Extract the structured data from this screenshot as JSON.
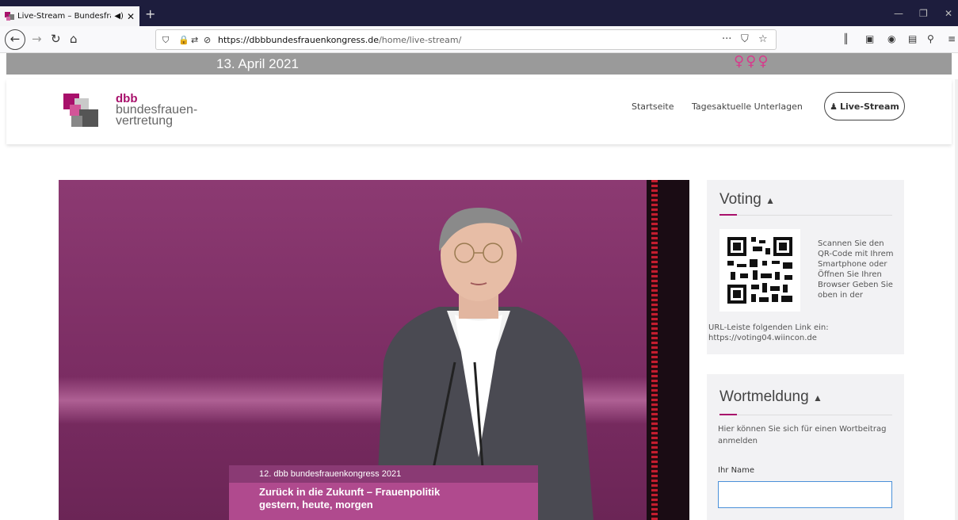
{
  "browser": {
    "tab_title": "Live-Stream – Bundesfrauen",
    "speaker_icon": "speaker-icon",
    "close_glyph": "✕",
    "new_tab_glyph": "+",
    "window_controls": [
      "—",
      "❐",
      "✕"
    ],
    "url_domain": "https://dbbbundesfrauenkongress.de",
    "url_path": "/home/live-stream/",
    "url_more": "···"
  },
  "page": {
    "date": "13. April 2021",
    "brand_line1": "dbb",
    "brand_line2": "bundesfrauen-",
    "brand_line3": "vertretung",
    "nav": {
      "startseite": "Startseite",
      "unterlagen": "Tagesaktuelle Unterlagen",
      "live": "Live-Stream"
    }
  },
  "video": {
    "banner_top": "12. dbb bundesfrauenkongress 2021",
    "banner_line1": "Zurück in die Zukunft – Frauenpolitik",
    "banner_line2": "gestern, heute, morgen"
  },
  "voting": {
    "title": "Voting",
    "text": "Scannen Sie den QR-Code mit Ihrem Smartphone oder Öffnen Sie Ihren Browser Geben Sie oben in der",
    "tail": "URL-Leiste folgenden Link ein: https://voting04.wiincon.de"
  },
  "wortmeldung": {
    "title": "Wortmeldung",
    "text": "Hier können Sie sich für einen Wortbeitrag anmelden",
    "name_label": "Ihr Name",
    "name_value": ""
  },
  "colors": {
    "brand": "#a8106b",
    "tabbar": "#1d1d3d",
    "video": "#8c3a72"
  }
}
